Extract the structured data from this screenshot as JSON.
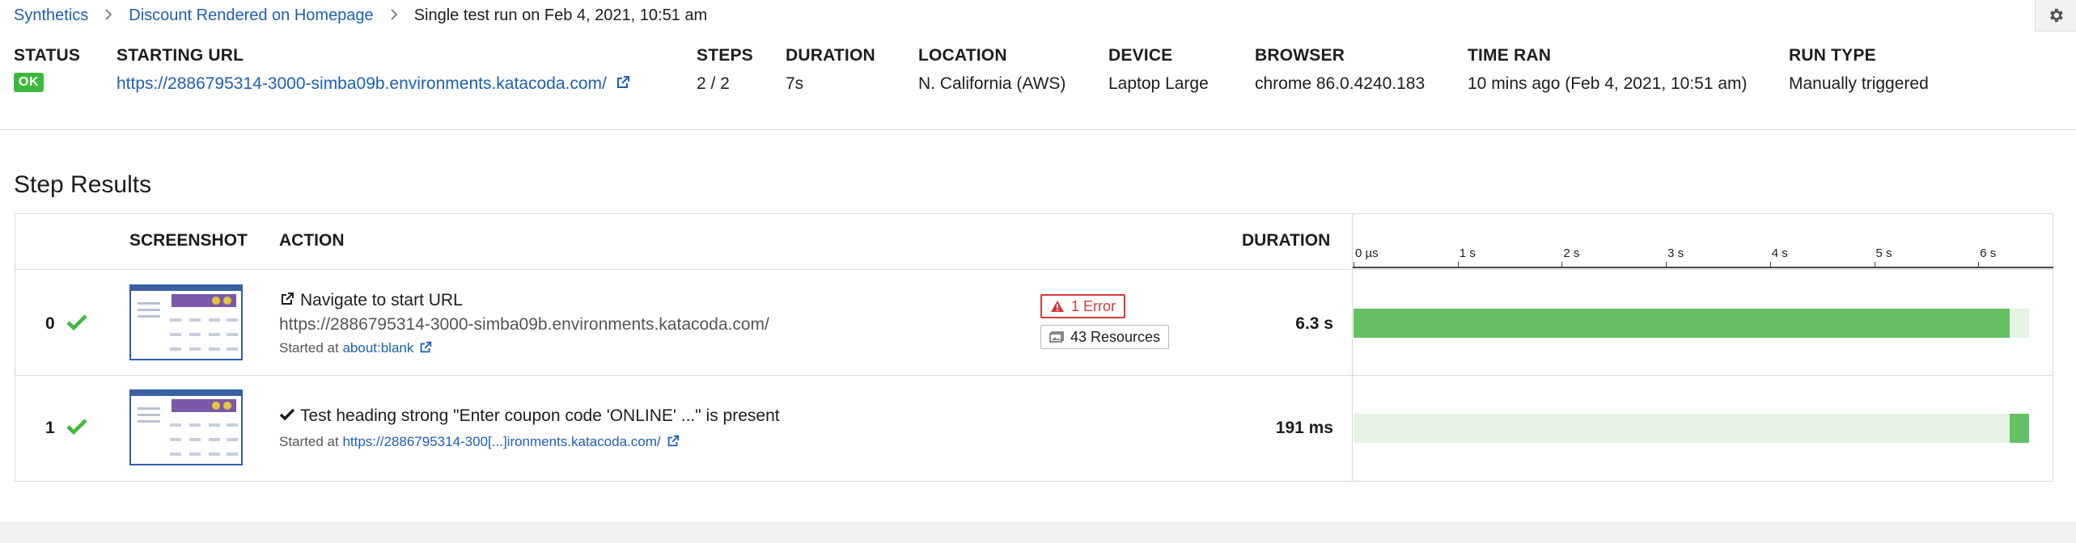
{
  "breadcrumb": {
    "items": [
      "Synthetics",
      "Discount Rendered on Homepage"
    ],
    "current": "Single test run on Feb 4, 2021, 10:51 am"
  },
  "summary": {
    "status_label": "STATUS",
    "status_value": "OK",
    "starting_url_label": "STARTING URL",
    "starting_url": "https://2886795314-3000-simba09b.environments.katacoda.com/",
    "steps_label": "STEPS",
    "steps": "2 / 2",
    "duration_label": "DURATION",
    "duration": "7s",
    "location_label": "LOCATION",
    "location": "N. California (AWS)",
    "device_label": "DEVICE",
    "device": "Laptop Large",
    "browser_label": "BROWSER",
    "browser": "chrome 86.0.4240.183",
    "time_ran_label": "TIME RAN",
    "time_ran": "10 mins ago (Feb 4, 2021, 10:51 am)",
    "run_type_label": "RUN TYPE",
    "run_type": "Manually triggered"
  },
  "step_results": {
    "title": "Step Results",
    "columns": [
      "SCREENSHOT",
      "ACTION",
      "DURATION"
    ],
    "timeline_ticks": [
      "0 µs",
      "1 s",
      "2 s",
      "3 s",
      "4 s",
      "5 s",
      "6 s"
    ],
    "steps": [
      {
        "index": "0",
        "action_title": "Navigate to start URL",
        "action_url": "https://2886795314-3000-simba09b.environments.katacoda.com/",
        "started_at_label": "Started at",
        "started_at": "about:blank",
        "error_badge": "1 Error",
        "resources_badge": "43 Resources",
        "duration": "6.3 s",
        "start_s": 0,
        "duration_s": 6.3
      },
      {
        "index": "1",
        "action_title": "Test heading strong \"Enter coupon code 'ONLINE' ...\" is present",
        "started_at_label": "Started at",
        "started_at": "https://2886795314-300[...]ironments.katacoda.com/",
        "duration": "191 ms",
        "start_s": 6.3,
        "duration_s": 0.191
      }
    ]
  },
  "colors": {
    "link": "#1d5fb0",
    "ok": "#3db83d",
    "error": "#d33a3a",
    "bar_fill": "#66c064",
    "bar_track": "#e5f4e5"
  }
}
